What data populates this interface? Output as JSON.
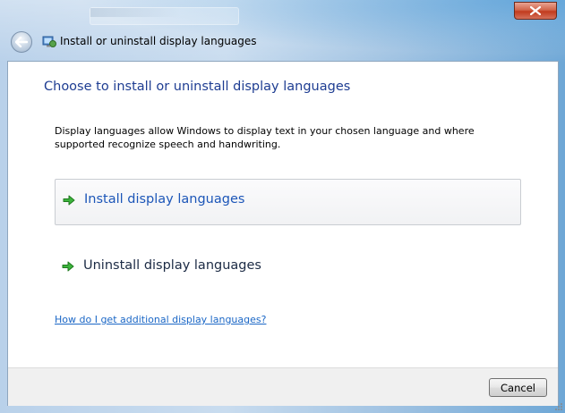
{
  "window": {
    "close_icon": "close-icon"
  },
  "nav": {
    "back_icon": "back-arrow-icon",
    "location_icon": "control-panel-icon",
    "title": "Install or uninstall display languages"
  },
  "main": {
    "heading": "Choose to install or uninstall display languages",
    "description": "Display languages allow Windows to display text in your chosen language and where supported recognize speech and handwriting.",
    "tasks": [
      {
        "label": "Install display languages",
        "icon": "green-arrow-icon",
        "state": "hover"
      },
      {
        "label": "Uninstall display languages",
        "icon": "green-arrow-icon",
        "state": "normal"
      }
    ],
    "help_link": "How do I get additional display languages?"
  },
  "footer": {
    "cancel_label": "Cancel"
  },
  "colors": {
    "heading": "#1e3d92",
    "link": "#1b67c6",
    "task_hover_text": "#1c56b8",
    "close_red": "#c23b1e"
  }
}
